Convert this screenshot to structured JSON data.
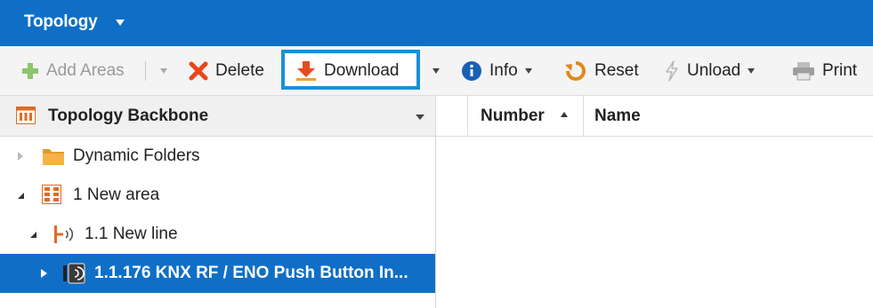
{
  "window": {
    "title": "Topology"
  },
  "toolbar": {
    "add_areas": "Add Areas",
    "delete": "Delete",
    "download": "Download",
    "info": "Info",
    "reset": "Reset",
    "unload": "Unload",
    "print": "Print"
  },
  "left_panel": {
    "header": "Topology Backbone",
    "tree": [
      {
        "label": "Dynamic Folders",
        "icon": "folder-icon",
        "state": "collapsed"
      },
      {
        "label": "1 New area",
        "icon": "area-icon",
        "state": "expanded"
      },
      {
        "label": "1.1 New line",
        "icon": "line-icon",
        "state": "expanded"
      },
      {
        "label": "1.1.176 KNX RF / ENO Push Button In...",
        "icon": "device-icon",
        "state": "collapsed",
        "selected": true
      }
    ]
  },
  "grid": {
    "columns": [
      "Number",
      "Name"
    ],
    "sort_column": "Number",
    "sort_direction": "ascending"
  },
  "colors": {
    "accent": "#0f6fc6",
    "highlight_border": "#1a8fd6",
    "download_icon": "#e84a1f",
    "delete_icon": "#e8451b",
    "add_icon": "#7bbf5a",
    "folder_icon": "#f0a23a"
  }
}
